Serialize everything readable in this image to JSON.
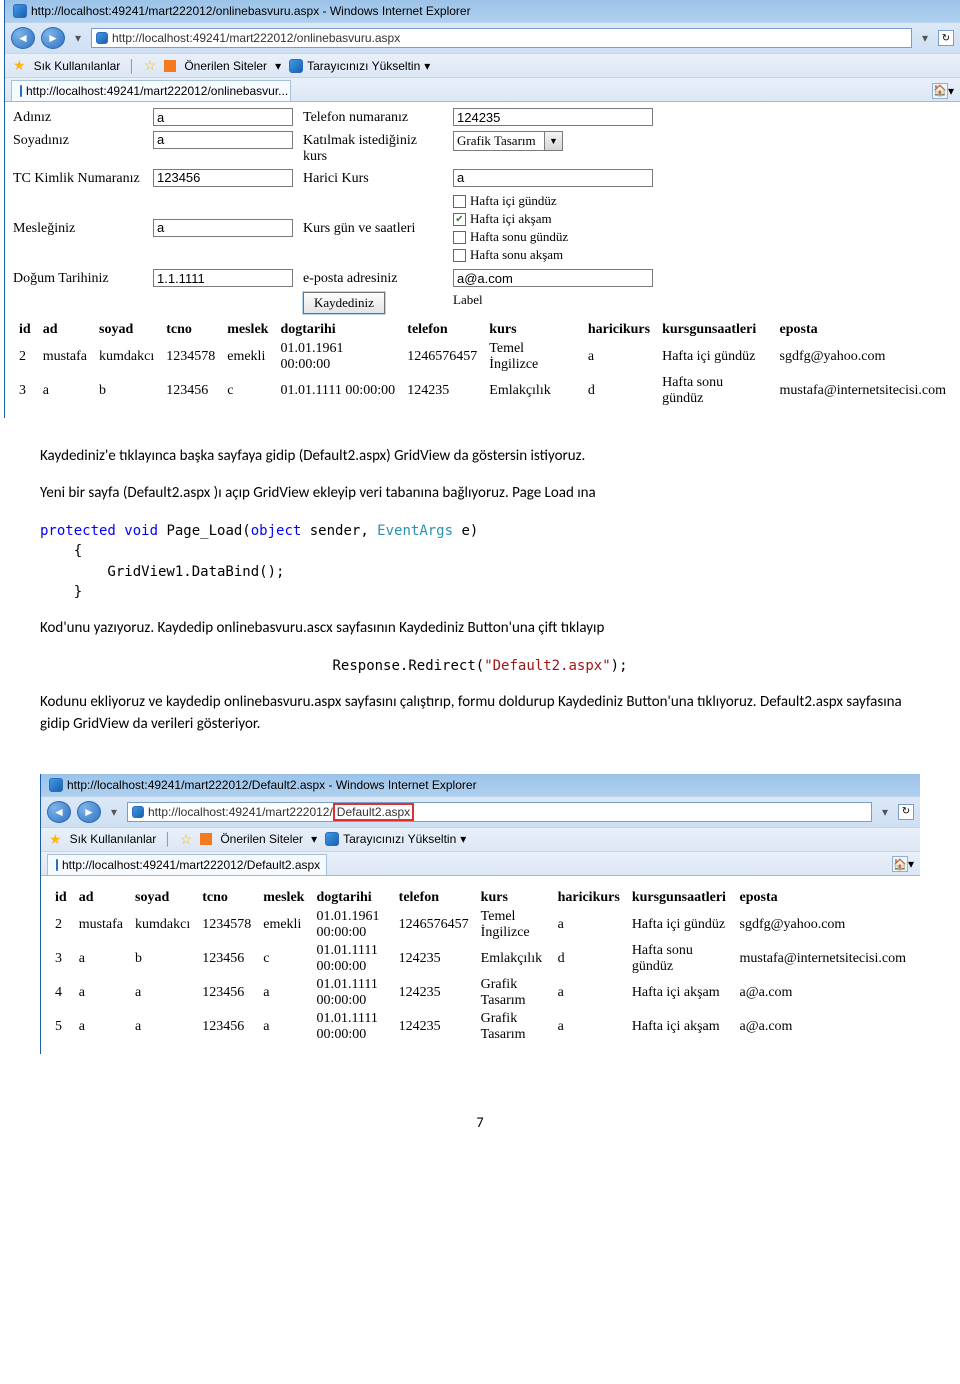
{
  "browser1": {
    "title": "http://localhost:49241/mart222012/onlinebasvuru.aspx - Windows Internet Explorer",
    "url": "http://localhost:49241/mart222012/onlinebasvuru.aspx",
    "fav_label": "Sık Kullanılanlar",
    "onerilen": "Önerilen Siteler",
    "tarayici": "Tarayıcınızı Yükseltin",
    "tab": "http://localhost:49241/mart222012/onlinebasvur..."
  },
  "form": {
    "adiniz": {
      "label": "Adınız",
      "value": "a"
    },
    "soyadiniz": {
      "label": "Soyadınız",
      "value": "a"
    },
    "tc": {
      "label": "TC Kimlik Numaranız",
      "value": "123456"
    },
    "meslek": {
      "label": "Mesleğiniz",
      "value": "a"
    },
    "dogum": {
      "label": "Doğum Tarihiniz",
      "value": "1.1.1111"
    },
    "tel": {
      "label": "Telefon numaranız",
      "value": "124235"
    },
    "kurs": {
      "label": "Katılmak istediğiniz kurs",
      "value": "Grafik Tasarım"
    },
    "harici": {
      "label": "Harici Kurs",
      "value": "a"
    },
    "saat": {
      "label": "Kurs gün ve saatleri",
      "opts": [
        "Hafta içi gündüz",
        "Hafta içi akşam",
        "Hafta sonu gündüz",
        "Hafta sonu akşam"
      ],
      "checked": 1
    },
    "eposta": {
      "label": "e-posta adresiniz",
      "value": "a@a.com"
    },
    "button": "Kaydediniz",
    "result": "Label"
  },
  "gv1": {
    "headers": [
      "id",
      "ad",
      "soyad",
      "tcno",
      "meslek",
      "dogtarihi",
      "telefon",
      "kurs",
      "haricikurs",
      "kursgunsaatleri",
      "eposta"
    ],
    "rows": [
      [
        "2",
        "mustafa",
        "kumdakcı",
        "1234578",
        "emekli",
        "01.01.1961 00:00:00",
        "1246576457",
        "Temel İngilizce",
        "a",
        "Hafta içi gündüz",
        "sgdfg@yahoo.com"
      ],
      [
        "3",
        "a",
        "b",
        "123456",
        "c",
        "01.01.1111 00:00:00",
        "124235",
        "Emlakçılık",
        "d",
        "Hafta sonu gündüz",
        "mustafa@internetsitecisi.com"
      ]
    ]
  },
  "doc": {
    "p1": "Kaydediniz'e tıklayınca başka sayfaya gidip (Default2.aspx) GridView da göstersin istiyoruz.",
    "p2": "Yeni bir sayfa (Default2.aspx )ı açıp GridView ekleyip veri tabanına bağlıyoruz. Page Load ına",
    "code1_a": "protected",
    "code1_b": " void",
    "code1_c": " Page_Load(",
    "code1_d": "object",
    "code1_e": " sender, ",
    "code1_f": "EventArgs",
    "code1_g": " e)",
    "code1_h": "    {",
    "code1_i": "        GridView1.DataBind();",
    "code1_j": "    }",
    "p3": "Kod'unu yazıyoruz. Kaydedip onlinebasvuru.ascx sayfasının Kaydediniz Button'una çift tıklayıp",
    "code2_a": "Response.Redirect(",
    "code2_b": "\"Default2.aspx\"",
    "code2_c": ");",
    "p4": "Kodunu ekliyoruz ve kaydedip onlinebasvuru.aspx sayfasını çalıştırıp, formu doldurup Kaydediniz Button'una tıklıyoruz. Default2.aspx sayfasına gidip GridView da verileri gösteriyor."
  },
  "browser2": {
    "title": "http://localhost:49241/mart222012/Default2.aspx - Windows Internet Explorer",
    "url_pre": "http://localhost:49241/mart222012/",
    "url_hl": "Default2.aspx",
    "fav_label": "Sık Kullanılanlar",
    "onerilen": "Önerilen Siteler",
    "tarayici": "Tarayıcınızı Yükseltin",
    "tab": "http://localhost:49241/mart222012/Default2.aspx"
  },
  "gv2": {
    "headers": [
      "id",
      "ad",
      "soyad",
      "tcno",
      "meslek",
      "dogtarihi",
      "telefon",
      "kurs",
      "haricikurs",
      "kursgunsaatleri",
      "eposta"
    ],
    "rows": [
      [
        "2",
        "mustafa",
        "kumdakcı",
        "1234578",
        "emekli",
        "01.01.1961 00:00:00",
        "1246576457",
        "Temel İngilizce",
        "a",
        "Hafta içi gündüz",
        "sgdfg@yahoo.com"
      ],
      [
        "3",
        "a",
        "b",
        "123456",
        "c",
        "01.01.1111 00:00:00",
        "124235",
        "Emlakçılık",
        "d",
        "Hafta sonu gündüz",
        "mustafa@internetsitecisi.com"
      ],
      [
        "4",
        "a",
        "a",
        "123456",
        "a",
        "01.01.1111 00:00:00",
        "124235",
        "Grafik Tasarım",
        "a",
        "Hafta içi akşam",
        "a@a.com"
      ],
      [
        "5",
        "a",
        "a",
        "123456",
        "a",
        "01.01.1111 00:00:00",
        "124235",
        "Grafik Tasarım",
        "a",
        "Hafta içi akşam",
        "a@a.com"
      ]
    ]
  },
  "pagenum": "7"
}
